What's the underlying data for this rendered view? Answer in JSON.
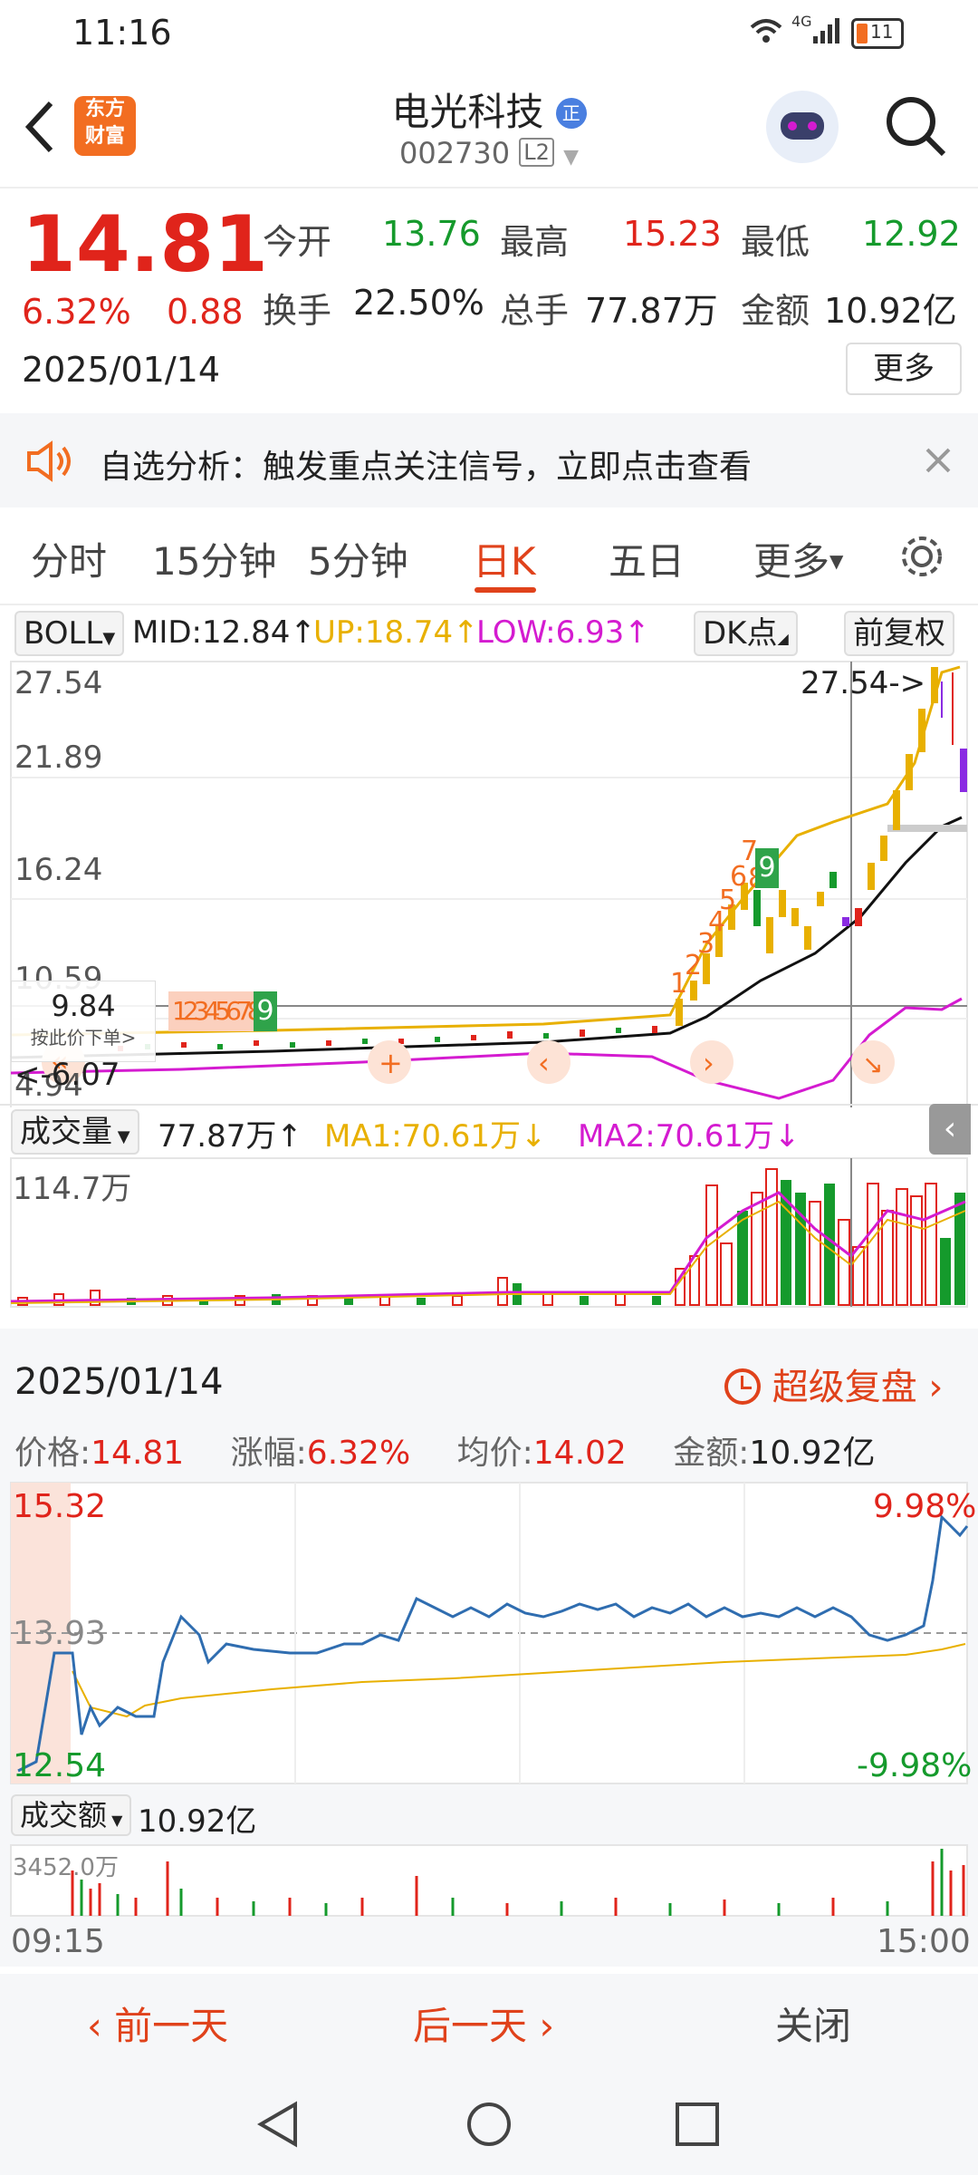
{
  "status": {
    "time": "11:16",
    "network": "4G",
    "battery": "11"
  },
  "header": {
    "logo_line1": "东方",
    "logo_line2": "财富",
    "name": "电光科技",
    "name_badge": "正",
    "code": "002730",
    "level": "L2"
  },
  "quote": {
    "price": "14.81",
    "change_pct": "6.32%",
    "change": "0.88",
    "date": "2025/01/14",
    "open_label": "今开",
    "open": "13.76",
    "high_label": "最高",
    "high": "15.23",
    "low_label": "最低",
    "low": "12.92",
    "turnover_label": "换手",
    "turnover": "22.50%",
    "volume_label": "总手",
    "volume": "77.87万",
    "amount_label": "金额",
    "amount": "10.92亿",
    "more": "更多"
  },
  "notice": {
    "text": "自选分析：触发重点关注信号，立即点击查看"
  },
  "tabs": [
    "分时",
    "15分钟",
    "5分钟",
    "日K",
    "五日",
    "更多"
  ],
  "active_tab": 3,
  "kline": {
    "indicator": "BOLL",
    "mid": "MID:12.84↑",
    "up": "UP:18.74↑",
    "low": "LOW:6.93↑",
    "dk_btn": "DK点",
    "fq_btn": "前复权",
    "y_labels": [
      "27.54",
      "21.89",
      "16.24",
      "10.59",
      "4.94"
    ],
    "max_annot": "27.54->",
    "min_annot": "<-6.07",
    "crosshair_price": "9.84",
    "crosshair_hint": "按此价下单",
    "seq_left": "12345678",
    "seq_left_green": "9",
    "seq_right": [
      "1",
      "2",
      "3",
      "4",
      "5",
      "6",
      "7",
      "8"
    ],
    "seq_right_green": "9"
  },
  "volume": {
    "indicator": "成交量",
    "value": "77.87万↑",
    "ma1": "MA1:70.61万↓",
    "ma2": "MA2:70.61万↓",
    "max": "114.7万"
  },
  "intraday": {
    "date": "2025/01/14",
    "replay": "超级复盘",
    "price_label": "价格:",
    "price": "14.81",
    "pct_label": "涨幅:",
    "pct": "6.32%",
    "avg_label": "均价:",
    "avg": "14.02",
    "amount_label": "金额:",
    "amount": "10.92亿",
    "y_high": "15.32",
    "y_mid": "13.93",
    "y_low": "12.54",
    "pct_high": "9.98%",
    "pct_low": "-9.98%",
    "vol_indicator": "成交额",
    "vol_value": "10.92亿",
    "vol_max": "3452.0万",
    "t_start": "09:15",
    "t_end": "15:00"
  },
  "footer": {
    "prev": "前一天",
    "next": "后一天",
    "close": "关闭"
  },
  "colors": {
    "up": "#e0241b",
    "down": "#159a2c",
    "ma_gold": "#e8b000",
    "ma_magenta": "#d41bd0",
    "accent": "#e0421b"
  }
}
